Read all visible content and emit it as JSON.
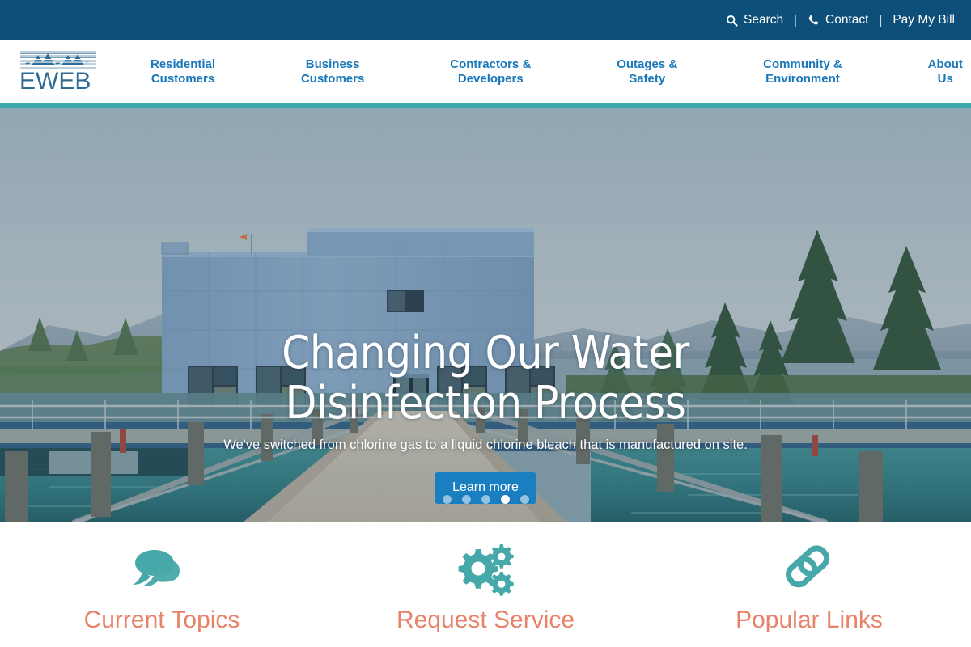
{
  "utility_bar": {
    "background": "#0d4f79",
    "items": [
      {
        "label": "Search",
        "icon": "search-icon"
      },
      {
        "label": "Contact",
        "icon": "phone-icon"
      },
      {
        "label": "Pay My Bill",
        "icon": "none"
      }
    ],
    "separator": "|"
  },
  "brand": {
    "name": "EWEB",
    "logo_icon": "eweb-mountain-logo",
    "color": "#2e6a94"
  },
  "nav": {
    "accent_color": "#3aa7ab",
    "link_color": "#1878b9",
    "items": [
      {
        "label": "Residential\nCustomers"
      },
      {
        "label": "Business\nCustomers"
      },
      {
        "label": "Contractors &\nDevelopers"
      },
      {
        "label": "Outages &\nSafety"
      },
      {
        "label": "Community &\nEnvironment"
      },
      {
        "label": "About\nUs"
      }
    ]
  },
  "hero": {
    "title": "Changing Our Water Disinfection Process",
    "subtitle": "We've switched from chlorine gas to a liquid chlorine bleach that is manufactured on site.",
    "button_label": "Learn more",
    "button_color": "#1a7fc1",
    "slides_total": 5,
    "active_slide": 4,
    "scene": "water-treatment-plant-walkway"
  },
  "cards": {
    "icon_color": "#46a8a8",
    "title_color": "#e8836a",
    "items": [
      {
        "title": "Current Topics",
        "icon": "speech-bubbles-icon"
      },
      {
        "title": "Request Service",
        "icon": "gears-icon"
      },
      {
        "title": "Popular Links",
        "icon": "chain-links-icon"
      }
    ]
  }
}
